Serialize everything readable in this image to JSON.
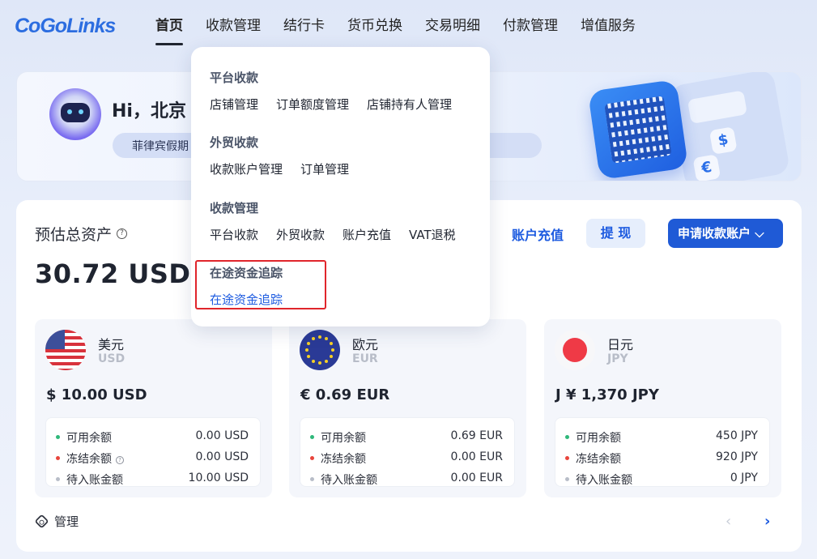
{
  "brand": {
    "logo_text": "CoGoLinks",
    "accent": "#1f5ad6"
  },
  "nav": {
    "items": [
      {
        "label": "首页",
        "active": true
      },
      {
        "label": "收款管理"
      },
      {
        "label": "结行卡"
      },
      {
        "label": "货币兑换"
      },
      {
        "label": "交易明细"
      },
      {
        "label": "付款管理"
      },
      {
        "label": "增值服务"
      }
    ]
  },
  "banner": {
    "greeting": "Hi，北京",
    "bank_tag": "菲律宾假期"
  },
  "dropdown": {
    "groups": [
      {
        "title": "平台收款",
        "links": [
          "店铺管理",
          "订单额度管理",
          "店铺持有人管理"
        ]
      },
      {
        "title": "外贸收款",
        "links": [
          "收款账户管理",
          "订单管理"
        ]
      },
      {
        "title": "收款管理",
        "links": [
          "平台收款",
          "外贸收款",
          "账户充值",
          "VAT退税"
        ]
      },
      {
        "title": "在途资金追踪",
        "links": [
          "在途资金追踪"
        ]
      }
    ]
  },
  "assets": {
    "label": "预估总资产",
    "help_icon": "question-circle-icon",
    "value": "30.72  USD",
    "recharge_label": "账户充值",
    "withdraw_label": "提 现",
    "apply_label": "申请收款账户 ⌵"
  },
  "currencies": [
    {
      "name": "美元",
      "code": "USD",
      "balance": "$ 10.00 USD",
      "flag_icon": "us-flag-icon",
      "rows": [
        {
          "label": "可用余额",
          "value": "0.00 USD",
          "dot": "#2fb87a"
        },
        {
          "label": "冻结余额",
          "value": "0.00 USD",
          "dot": "#e8453c",
          "help": true
        },
        {
          "label": "待入账金额",
          "value": "10.00 USD",
          "dot": "#b8bdc8"
        }
      ]
    },
    {
      "name": "欧元",
      "code": "EUR",
      "balance": "€ 0.69 EUR",
      "flag_icon": "eu-flag-icon",
      "rows": [
        {
          "label": "可用余额",
          "value": "0.69 EUR",
          "dot": "#2fb87a"
        },
        {
          "label": "冻结余额",
          "value": "0.00 EUR",
          "dot": "#e8453c"
        },
        {
          "label": "待入账金额",
          "value": "0.00 EUR",
          "dot": "#b8bdc8"
        }
      ]
    },
    {
      "name": "日元",
      "code": "JPY",
      "balance": "J ¥ 1,370 JPY",
      "flag_icon": "jp-flag-icon",
      "rows": [
        {
          "label": "可用余额",
          "value": "450 JPY",
          "dot": "#2fb87a"
        },
        {
          "label": "冻结余额",
          "value": "920 JPY",
          "dot": "#e8453c"
        },
        {
          "label": "待入账金额",
          "value": "0 JPY",
          "dot": "#b8bdc8"
        }
      ]
    }
  ],
  "footer": {
    "manage_label": "管理",
    "prev_icon": "chevron-left-icon",
    "next_icon": "chevron-right-icon"
  }
}
